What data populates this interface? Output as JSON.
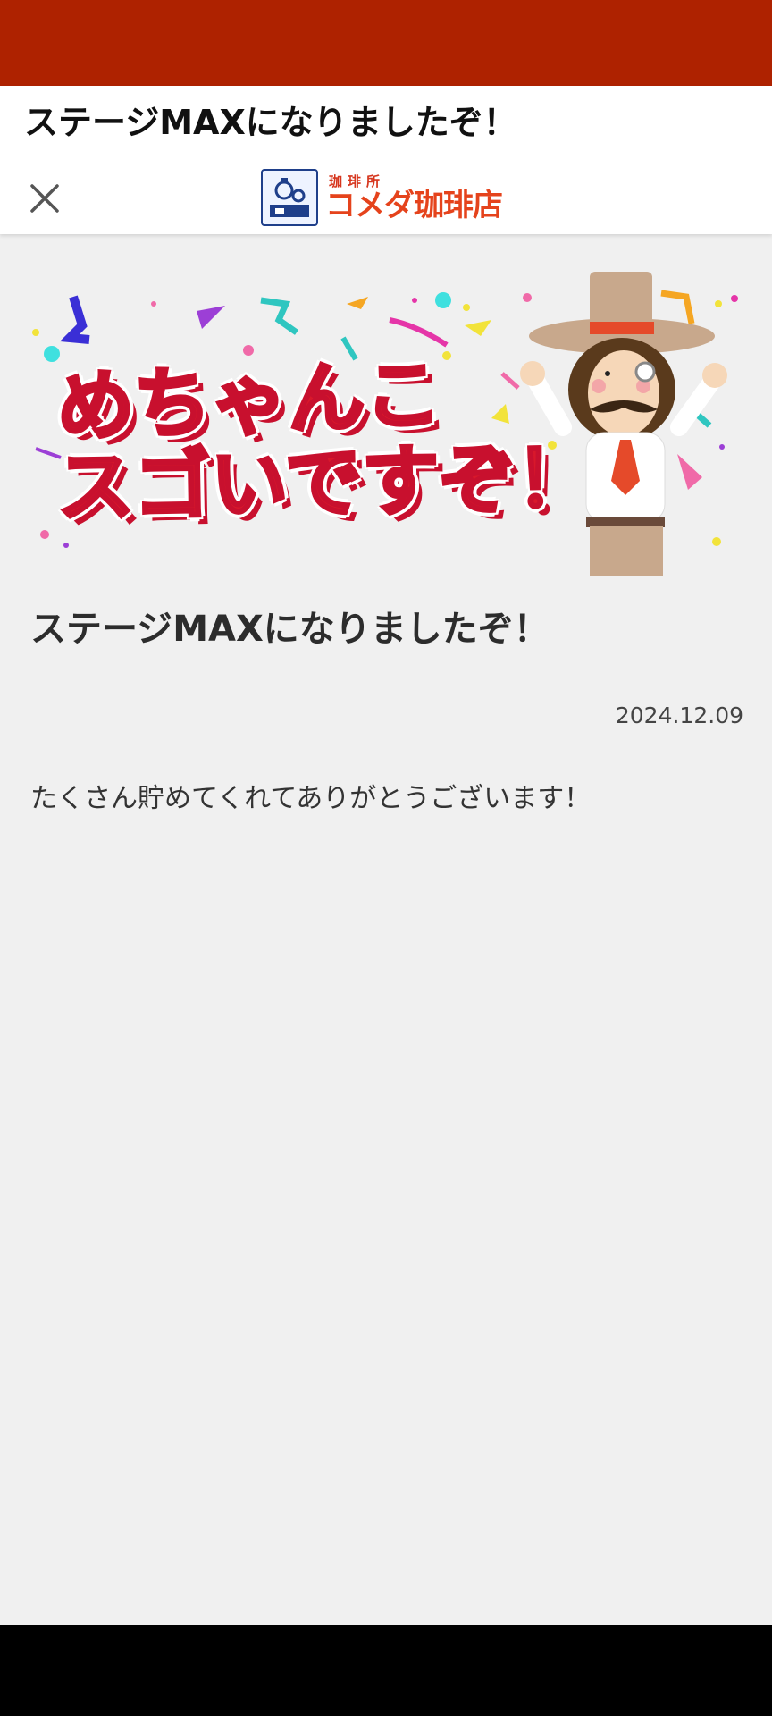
{
  "header": {
    "title": "ステージMAXになりましたぞ！",
    "logo": {
      "sub_text": "珈琲所",
      "main_text": "コメダ珈琲店"
    }
  },
  "banner": {
    "line1": "めちゃんこ",
    "line2": "スゴいですぞ！"
  },
  "article": {
    "title": "ステージMAXになりましたぞ！",
    "date": "2024.12.09",
    "body": "たくさん貯めてくれてありがとうございます！"
  },
  "colors": {
    "status_bar": "#ae2200",
    "brand_red": "#e5431c",
    "banner_red": "#d8182b",
    "background": "#f0f0f0"
  },
  "icons": {
    "close": "close-icon"
  }
}
